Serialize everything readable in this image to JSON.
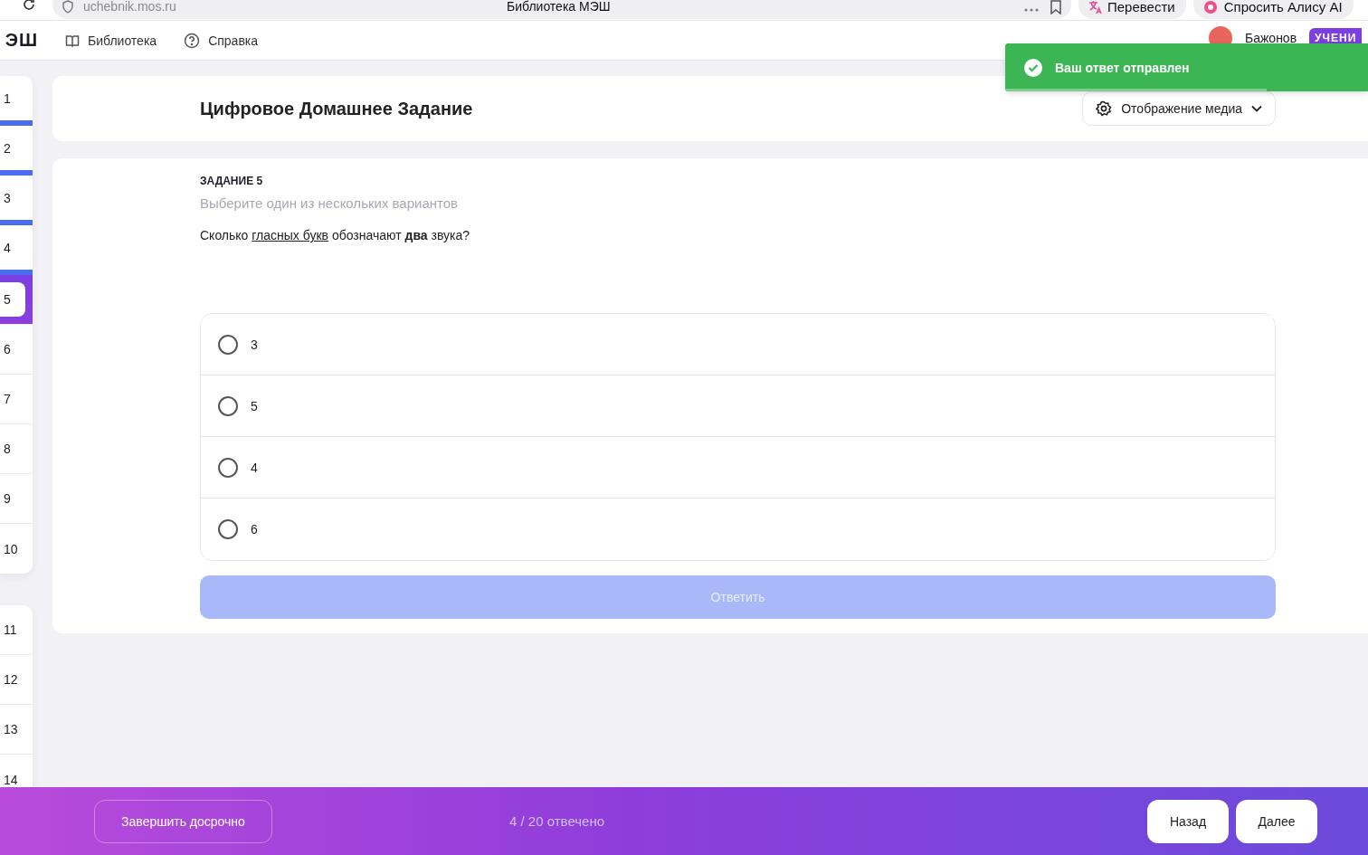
{
  "browser": {
    "url": "uchebnik.mos.ru",
    "tab_title": "Библиотека МЭШ",
    "buttons": [
      {
        "label": "Перевести",
        "kind": "translate"
      },
      {
        "label": "Спросить Алису AI",
        "kind": "alice"
      }
    ]
  },
  "header": {
    "logo": "ЭШ",
    "nav": [
      {
        "label": "Библиотека",
        "kind": "book"
      },
      {
        "label": "Справка",
        "kind": "help"
      }
    ],
    "user_name": "Бажонов",
    "role": "УЧЕНИ"
  },
  "toast": {
    "message": "Ваш ответ отправлен",
    "level": 0.72
  },
  "question_nav": [
    [
      {
        "label": "1",
        "answered": true,
        "selected": false
      },
      {
        "label": "2",
        "answered": true,
        "selected": false
      },
      {
        "label": "3",
        "answered": true,
        "selected": false
      },
      {
        "label": "4",
        "answered": true,
        "selected": false
      },
      {
        "label": "5",
        "answered": false,
        "selected": true
      },
      {
        "label": "6",
        "answered": false,
        "selected": false
      },
      {
        "label": "7",
        "answered": false,
        "selected": false
      },
      {
        "label": "8",
        "answered": false,
        "selected": false
      },
      {
        "label": "9",
        "answered": false,
        "selected": false
      },
      {
        "label": "10",
        "answered": false,
        "selected": false
      }
    ],
    [
      {
        "label": "11",
        "answered": false,
        "selected": false
      },
      {
        "label": "12",
        "answered": false,
        "selected": false
      },
      {
        "label": "13",
        "answered": false,
        "selected": false
      },
      {
        "label": "14",
        "answered": false,
        "selected": false
      }
    ]
  ],
  "page_title": "Цифровое Домашнее Задание",
  "media_button": "Отображение медиа",
  "task": {
    "number": "ЗАДАНИЕ 5",
    "instruction": "Выберите один из нескольких вариантов",
    "question": {
      "before": "Сколько ",
      "link": "гласных букв",
      "after": " обозначают **два** звука?"
    },
    "options": [
      {
        "label": "3",
        "selected": false
      },
      {
        "label": "5",
        "selected": false
      },
      {
        "label": "4",
        "selected": false
      },
      {
        "label": "6",
        "selected": false
      }
    ],
    "submit": {
      "label": "Ответить",
      "disabled": true
    }
  },
  "footer": {
    "finish": "Завершить досрочно",
    "progress": "4 / 20 отвечено",
    "back": "Назад",
    "next": "Далее"
  }
}
